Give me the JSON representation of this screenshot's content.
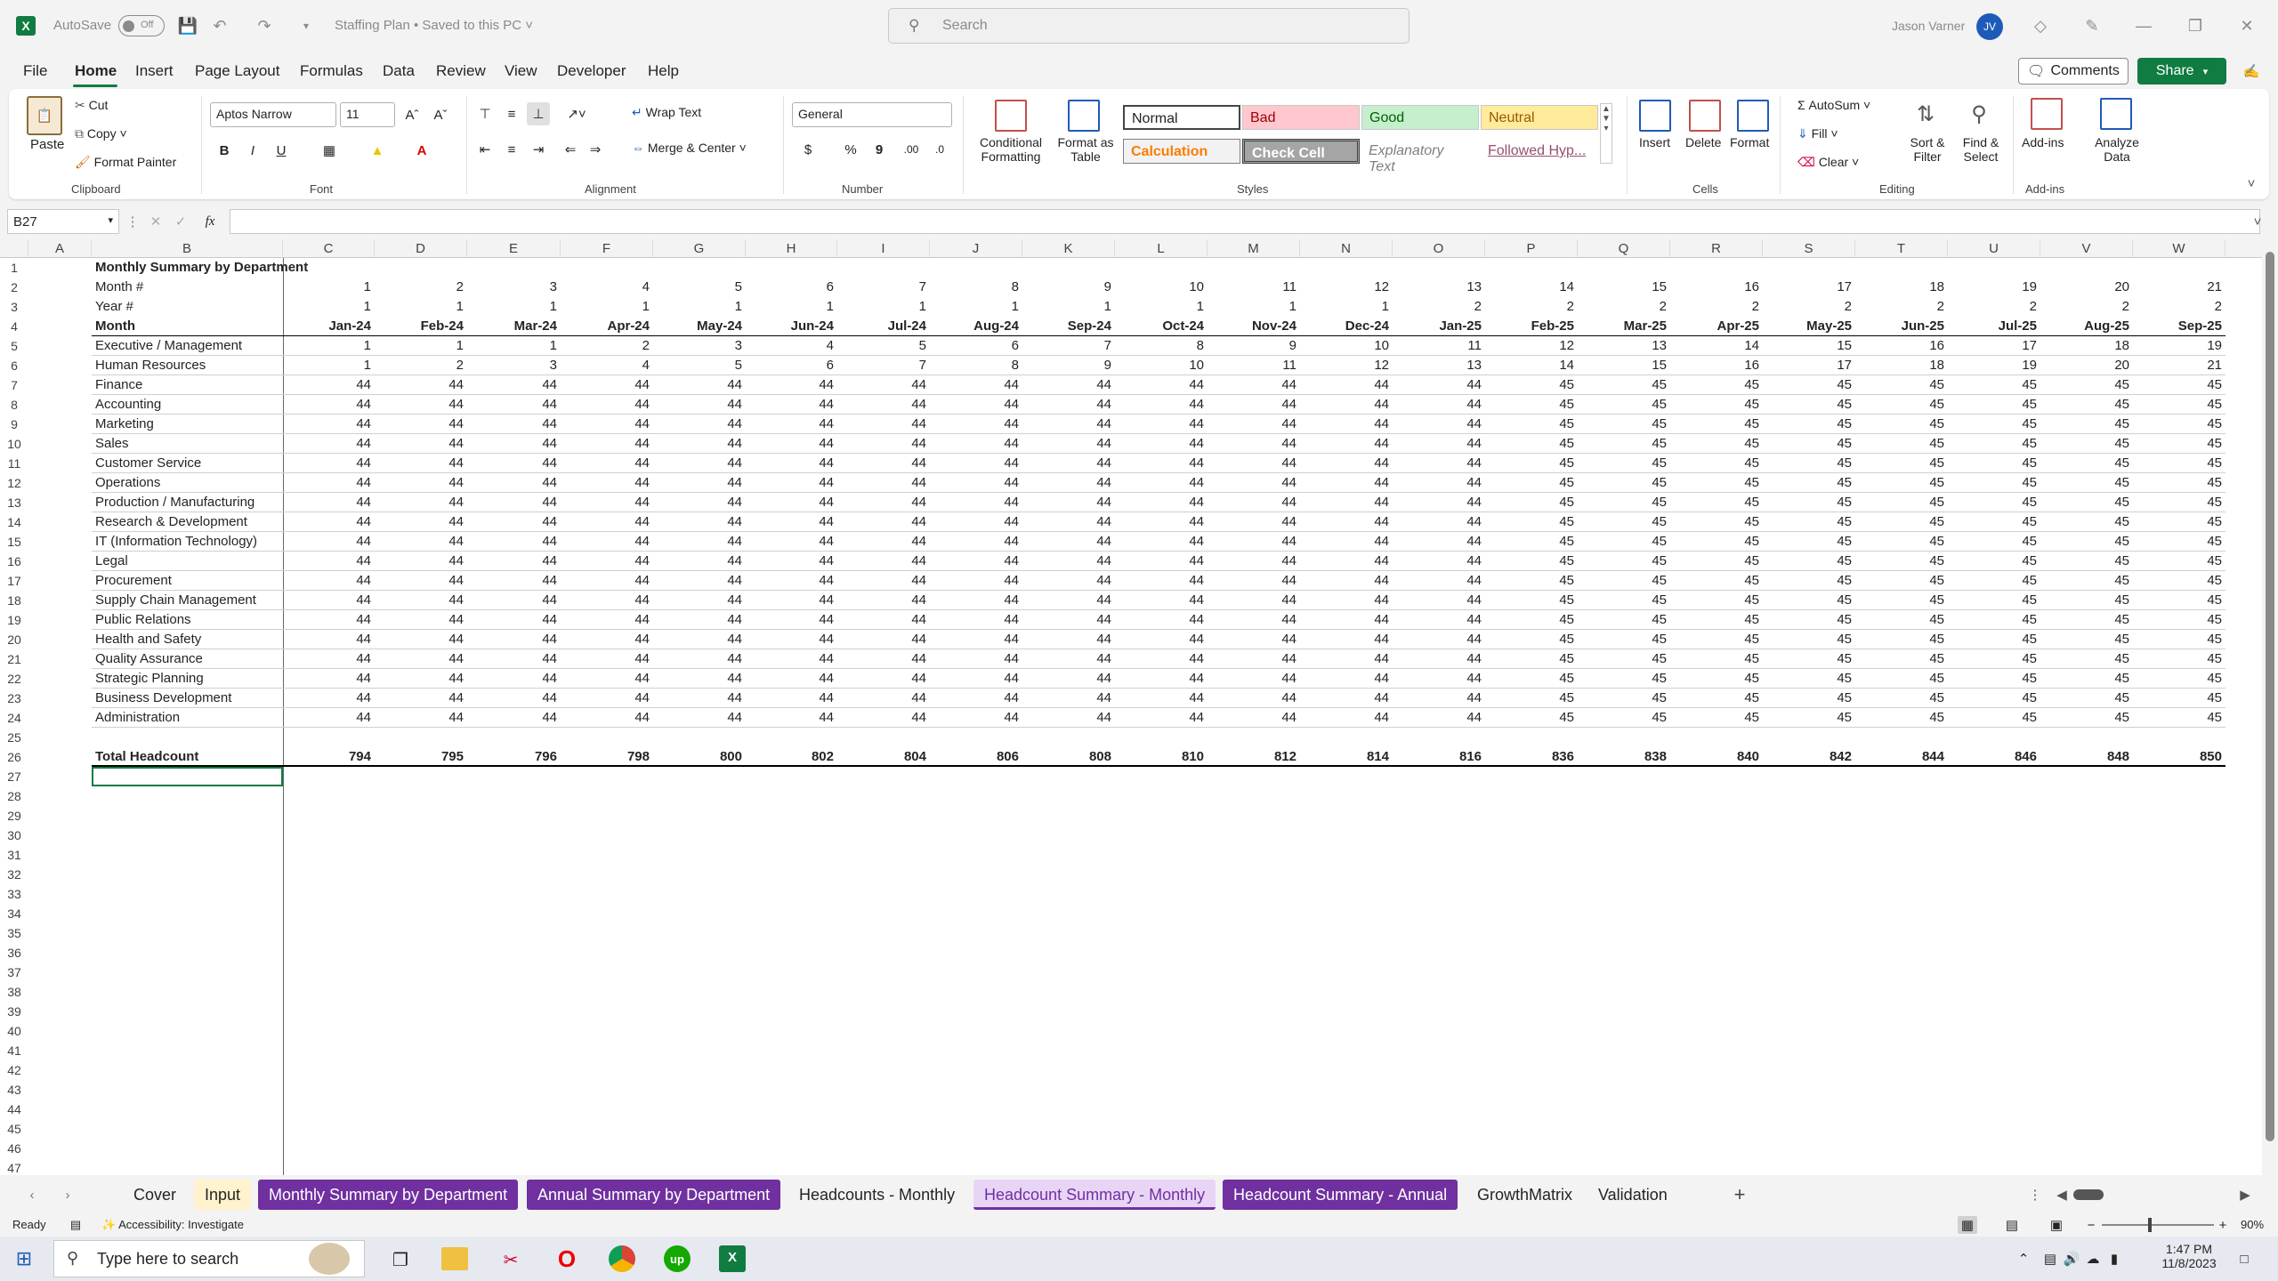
{
  "titlebar": {
    "autosave_label": "AutoSave",
    "autosave_state": "Off",
    "doc_title": "Staffing Plan • Saved to this PC",
    "search_placeholder": "Search",
    "user_name": "Jason Varner",
    "user_initials": "JV"
  },
  "menu": [
    "File",
    "Home",
    "Insert",
    "Page Layout",
    "Formulas",
    "Data",
    "Review",
    "View",
    "Developer",
    "Help"
  ],
  "menu_right": {
    "comments": "Comments",
    "share": "Share"
  },
  "ribbon": {
    "clipboard": {
      "paste": "Paste",
      "cut": "Cut",
      "copy": "Copy",
      "format_painter": "Format Painter",
      "label": "Clipboard"
    },
    "font": {
      "name": "Aptos Narrow",
      "size": "11",
      "label": "Font"
    },
    "alignment": {
      "wrap": "Wrap Text",
      "merge": "Merge & Center",
      "label": "Alignment"
    },
    "number": {
      "format": "General",
      "label": "Number"
    },
    "styles": {
      "cond": "Conditional Formatting",
      "table": "Format as Table",
      "label": "Styles",
      "cells": [
        {
          "text": "Normal",
          "bg": "#ffffff",
          "fg": "#000000"
        },
        {
          "text": "Bad",
          "bg": "#ffc7ce",
          "fg": "#9c0006"
        },
        {
          "text": "Good",
          "bg": "#c6efce",
          "fg": "#006100"
        },
        {
          "text": "Neutral",
          "bg": "#ffeb9c",
          "fg": "#9c5700"
        },
        {
          "text": "Calculation",
          "bg": "#f2f2f2",
          "fg": "#fa7d00"
        },
        {
          "text": "Check Cell",
          "bg": "#a5a5a5",
          "fg": "#ffffff"
        },
        {
          "text": "Explanatory Text",
          "bg": "#ffffff",
          "fg": "#7f7f7f"
        },
        {
          "text": "Followed Hyp...",
          "bg": "#ffffff",
          "fg": "#954f72"
        }
      ]
    },
    "cells": {
      "insert": "Insert",
      "delete": "Delete",
      "format": "Format",
      "label": "Cells"
    },
    "editing": {
      "autosum": "AutoSum",
      "fill": "Fill",
      "clear": "Clear",
      "sort": "Sort & Filter",
      "find": "Find & Select",
      "label": "Editing"
    },
    "addins": {
      "addins": "Add-ins",
      "analyze": "Analyze Data",
      "label": "Add-ins"
    }
  },
  "formula_bar": {
    "name_box": "B27",
    "formula": ""
  },
  "sheet": {
    "columns": [
      "A",
      "B",
      "C",
      "D",
      "E",
      "F",
      "G",
      "H",
      "I",
      "J",
      "K",
      "L",
      "M",
      "N",
      "O",
      "P",
      "Q",
      "R",
      "S",
      "T",
      "U",
      "V",
      "W"
    ],
    "title": "Monthly Summary by Department",
    "month_label": "Month #",
    "year_label": "Year #",
    "month_name_label": "Month",
    "month_nums": [
      "1",
      "2",
      "3",
      "4",
      "5",
      "6",
      "7",
      "8",
      "9",
      "10",
      "11",
      "12",
      "13",
      "14",
      "15",
      "16",
      "17",
      "18",
      "19",
      "20",
      "21"
    ],
    "year_nums": [
      "1",
      "1",
      "1",
      "1",
      "1",
      "1",
      "1",
      "1",
      "1",
      "1",
      "1",
      "1",
      "2",
      "2",
      "2",
      "2",
      "2",
      "2",
      "2",
      "2",
      "2"
    ],
    "months": [
      "Jan-24",
      "Feb-24",
      "Mar-24",
      "Apr-24",
      "May-24",
      "Jun-24",
      "Jul-24",
      "Aug-24",
      "Sep-24",
      "Oct-24",
      "Nov-24",
      "Dec-24",
      "Jan-25",
      "Feb-25",
      "Mar-25",
      "Apr-25",
      "May-25",
      "Jun-25",
      "Jul-25",
      "Aug-25",
      "Sep-25"
    ],
    "departments": [
      {
        "name": "Executive / Management",
        "values": [
          "1",
          "1",
          "1",
          "2",
          "3",
          "4",
          "5",
          "6",
          "7",
          "8",
          "9",
          "10",
          "11",
          "12",
          "13",
          "14",
          "15",
          "16",
          "17",
          "18",
          "19"
        ]
      },
      {
        "name": "Human Resources",
        "values": [
          "1",
          "2",
          "3",
          "4",
          "5",
          "6",
          "7",
          "8",
          "9",
          "10",
          "11",
          "12",
          "13",
          "14",
          "15",
          "16",
          "17",
          "18",
          "19",
          "20",
          "21"
        ]
      },
      {
        "name": "Finance",
        "values": [
          "44",
          "44",
          "44",
          "44",
          "44",
          "44",
          "44",
          "44",
          "44",
          "44",
          "44",
          "44",
          "44",
          "45",
          "45",
          "45",
          "45",
          "45",
          "45",
          "45",
          "45"
        ]
      },
      {
        "name": "Accounting",
        "values": [
          "44",
          "44",
          "44",
          "44",
          "44",
          "44",
          "44",
          "44",
          "44",
          "44",
          "44",
          "44",
          "44",
          "45",
          "45",
          "45",
          "45",
          "45",
          "45",
          "45",
          "45"
        ]
      },
      {
        "name": "Marketing",
        "values": [
          "44",
          "44",
          "44",
          "44",
          "44",
          "44",
          "44",
          "44",
          "44",
          "44",
          "44",
          "44",
          "44",
          "45",
          "45",
          "45",
          "45",
          "45",
          "45",
          "45",
          "45"
        ]
      },
      {
        "name": "Sales",
        "values": [
          "44",
          "44",
          "44",
          "44",
          "44",
          "44",
          "44",
          "44",
          "44",
          "44",
          "44",
          "44",
          "44",
          "45",
          "45",
          "45",
          "45",
          "45",
          "45",
          "45",
          "45"
        ]
      },
      {
        "name": "Customer Service",
        "values": [
          "44",
          "44",
          "44",
          "44",
          "44",
          "44",
          "44",
          "44",
          "44",
          "44",
          "44",
          "44",
          "44",
          "45",
          "45",
          "45",
          "45",
          "45",
          "45",
          "45",
          "45"
        ]
      },
      {
        "name": "Operations",
        "values": [
          "44",
          "44",
          "44",
          "44",
          "44",
          "44",
          "44",
          "44",
          "44",
          "44",
          "44",
          "44",
          "44",
          "45",
          "45",
          "45",
          "45",
          "45",
          "45",
          "45",
          "45"
        ]
      },
      {
        "name": "Production / Manufacturing",
        "values": [
          "44",
          "44",
          "44",
          "44",
          "44",
          "44",
          "44",
          "44",
          "44",
          "44",
          "44",
          "44",
          "44",
          "45",
          "45",
          "45",
          "45",
          "45",
          "45",
          "45",
          "45"
        ]
      },
      {
        "name": "Research & Development",
        "values": [
          "44",
          "44",
          "44",
          "44",
          "44",
          "44",
          "44",
          "44",
          "44",
          "44",
          "44",
          "44",
          "44",
          "45",
          "45",
          "45",
          "45",
          "45",
          "45",
          "45",
          "45"
        ]
      },
      {
        "name": "IT (Information Technology)",
        "values": [
          "44",
          "44",
          "44",
          "44",
          "44",
          "44",
          "44",
          "44",
          "44",
          "44",
          "44",
          "44",
          "44",
          "45",
          "45",
          "45",
          "45",
          "45",
          "45",
          "45",
          "45"
        ]
      },
      {
        "name": "Legal",
        "values": [
          "44",
          "44",
          "44",
          "44",
          "44",
          "44",
          "44",
          "44",
          "44",
          "44",
          "44",
          "44",
          "44",
          "45",
          "45",
          "45",
          "45",
          "45",
          "45",
          "45",
          "45"
        ]
      },
      {
        "name": "Procurement",
        "values": [
          "44",
          "44",
          "44",
          "44",
          "44",
          "44",
          "44",
          "44",
          "44",
          "44",
          "44",
          "44",
          "44",
          "45",
          "45",
          "45",
          "45",
          "45",
          "45",
          "45",
          "45"
        ]
      },
      {
        "name": "Supply Chain Management",
        "values": [
          "44",
          "44",
          "44",
          "44",
          "44",
          "44",
          "44",
          "44",
          "44",
          "44",
          "44",
          "44",
          "44",
          "45",
          "45",
          "45",
          "45",
          "45",
          "45",
          "45",
          "45"
        ]
      },
      {
        "name": "Public Relations",
        "values": [
          "44",
          "44",
          "44",
          "44",
          "44",
          "44",
          "44",
          "44",
          "44",
          "44",
          "44",
          "44",
          "44",
          "45",
          "45",
          "45",
          "45",
          "45",
          "45",
          "45",
          "45"
        ]
      },
      {
        "name": "Health and Safety",
        "values": [
          "44",
          "44",
          "44",
          "44",
          "44",
          "44",
          "44",
          "44",
          "44",
          "44",
          "44",
          "44",
          "44",
          "45",
          "45",
          "45",
          "45",
          "45",
          "45",
          "45",
          "45"
        ]
      },
      {
        "name": "Quality Assurance",
        "values": [
          "44",
          "44",
          "44",
          "44",
          "44",
          "44",
          "44",
          "44",
          "44",
          "44",
          "44",
          "44",
          "44",
          "45",
          "45",
          "45",
          "45",
          "45",
          "45",
          "45",
          "45"
        ]
      },
      {
        "name": "Strategic Planning",
        "values": [
          "44",
          "44",
          "44",
          "44",
          "44",
          "44",
          "44",
          "44",
          "44",
          "44",
          "44",
          "44",
          "44",
          "45",
          "45",
          "45",
          "45",
          "45",
          "45",
          "45",
          "45"
        ]
      },
      {
        "name": "Business Development",
        "values": [
          "44",
          "44",
          "44",
          "44",
          "44",
          "44",
          "44",
          "44",
          "44",
          "44",
          "44",
          "44",
          "44",
          "45",
          "45",
          "45",
          "45",
          "45",
          "45",
          "45",
          "45"
        ]
      },
      {
        "name": "Administration",
        "values": [
          "44",
          "44",
          "44",
          "44",
          "44",
          "44",
          "44",
          "44",
          "44",
          "44",
          "44",
          "44",
          "44",
          "45",
          "45",
          "45",
          "45",
          "45",
          "45",
          "45",
          "45"
        ]
      }
    ],
    "total_label": "Total Headcount",
    "totals": [
      "794",
      "795",
      "796",
      "798",
      "800",
      "802",
      "804",
      "806",
      "808",
      "810",
      "812",
      "814",
      "816",
      "836",
      "838",
      "840",
      "842",
      "844",
      "846",
      "848",
      "850"
    ],
    "row_numbers": [
      "1",
      "2",
      "3",
      "4",
      "5",
      "6",
      "7",
      "8",
      "9",
      "10",
      "11",
      "12",
      "13",
      "14",
      "15",
      "16",
      "17",
      "18",
      "19",
      "20",
      "21",
      "22",
      "23",
      "24",
      "25",
      "26",
      "27",
      "28",
      "29",
      "30",
      "31",
      "32",
      "33",
      "34",
      "35",
      "36",
      "37",
      "38",
      "39",
      "40",
      "41",
      "42",
      "43",
      "44",
      "45",
      "46",
      "47"
    ]
  },
  "tabs": [
    {
      "label": "Cover",
      "style": "plain"
    },
    {
      "label": "Input",
      "style": "yellow"
    },
    {
      "label": "Monthly Summary by Department",
      "style": "purple"
    },
    {
      "label": "Annual Summary by Department",
      "style": "purple"
    },
    {
      "label": "Headcounts - Monthly",
      "style": "plain"
    },
    {
      "label": "Headcount Summary - Monthly",
      "style": "active"
    },
    {
      "label": "Headcount Summary - Annual",
      "style": "purple"
    },
    {
      "label": "GrowthMatrix",
      "style": "plain"
    },
    {
      "label": "Validation",
      "style": "plain"
    }
  ],
  "status": {
    "ready": "Ready",
    "accessibility": "Accessibility: Investigate",
    "zoom": "90%"
  },
  "taskbar": {
    "search_placeholder": "Type here to search",
    "time": "1:47 PM",
    "date": "11/8/2023"
  }
}
